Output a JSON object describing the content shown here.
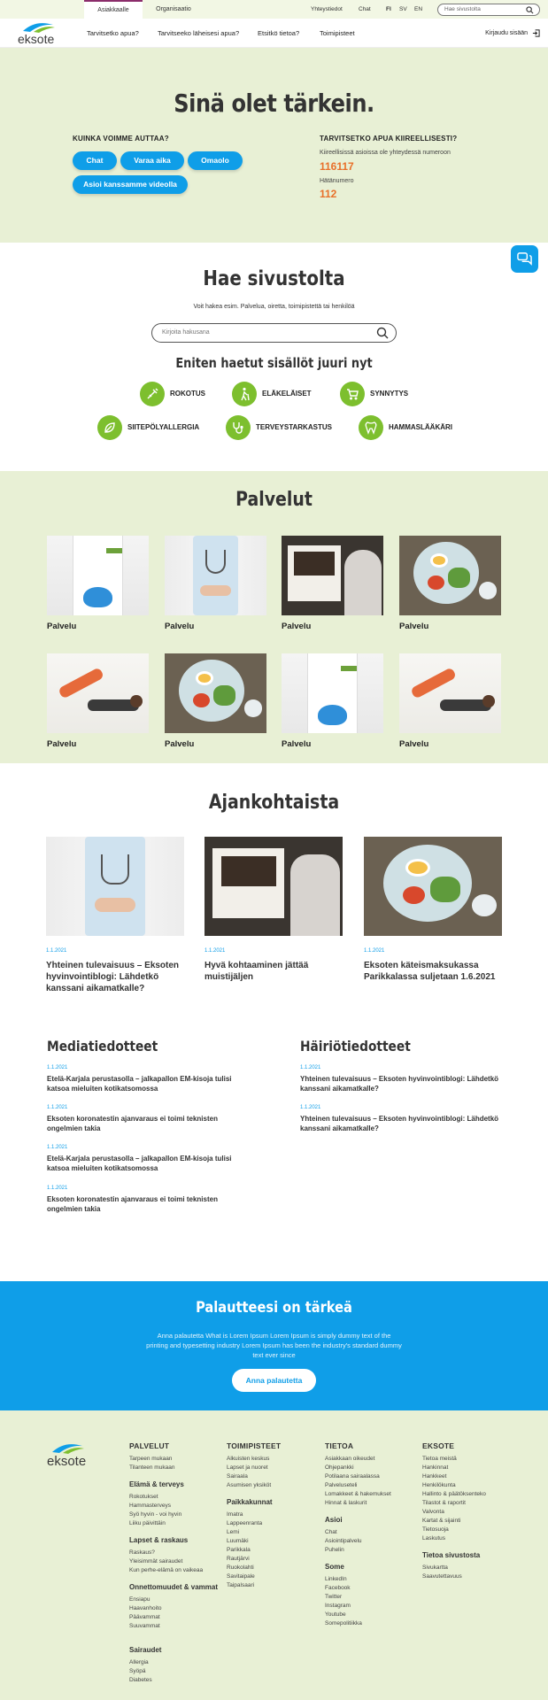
{
  "topbar": {
    "tabs": [
      "Asiakkaalle",
      "Organisaatio"
    ],
    "utils": [
      "Yhteystiedot",
      "Chat"
    ],
    "langs": [
      "FI",
      "SV",
      "EN"
    ],
    "search_placeholder": "Hae sivustolta"
  },
  "header": {
    "logo_text": "eksote",
    "nav": [
      "Tarvitsetko apua?",
      "Tarvitseeko läheisesi apua?",
      "Etsitkö tietoa?",
      "Toimipisteet"
    ],
    "login": "Kirjaudu sisään"
  },
  "hero": {
    "title": "Sinä olet tärkein.",
    "help_label": "KUINKA VOIMME AUTTAA?",
    "buttons": [
      "Chat",
      "Varaa aika",
      "Omaolo",
      "Asioi kanssamme videolla"
    ],
    "urgent_label": "TARVITSETKO APUA KIIREELLISESTI?",
    "urgent_text": "Kiireellisissä asioissa ole yhteydessä numeroon",
    "urgent_number": "116117",
    "emergency_text": "Hätänumero",
    "emergency_number": "112"
  },
  "search": {
    "title": "Hae sivustolta",
    "subtitle": "Voit hakea esim. Palvelua, oiretta, toimipistettä tai henkilöä",
    "placeholder": "Kirjoita hakusana",
    "popular_title": "Eniten haetut sisällöt juuri nyt",
    "popular": [
      "ROKOTUS",
      "ELÄKELÄISET",
      "SYNNYTYS",
      "SIITEPÖLYALLERGIA",
      "TERVEYSTARKASTUS",
      "HAMMASLÄÄKÄRI"
    ]
  },
  "services": {
    "title": "Palvelut",
    "cards": [
      "Palvelu",
      "Palvelu",
      "Palvelu",
      "Palvelu",
      "Palvelu",
      "Palvelu",
      "Palvelu",
      "Palvelu"
    ]
  },
  "news": {
    "title": "Ajankohtaista",
    "items": [
      {
        "date": "1.1.2021",
        "title": "Yhteinen tulevaisuus – Eksoten hyvinvointiblogi: Lähdetkö kanssani aikamatkalle?"
      },
      {
        "date": "1.1.2021",
        "title": "Hyvä kohtaaminen jättää muistijäljen"
      },
      {
        "date": "1.1.2021",
        "title": "Eksoten käteismaksukassa Parikkalassa suljetaan 1.6.2021"
      }
    ]
  },
  "media": {
    "title": "Mediatiedotteet",
    "items": [
      {
        "date": "1.1.2021",
        "title": "Etelä-Karjala perustasolla – jalkapallon EM-kisoja tulisi katsoa mieluiten kotikatsomossa"
      },
      {
        "date": "1.1.2021",
        "title": "Eksoten koronatestin ajanvaraus ei toimi teknisten ongelmien takia"
      },
      {
        "date": "1.1.2021",
        "title": "Etelä-Karjala perustasolla – jalkapallon EM-kisoja tulisi katsoa mieluiten kotikatsomossa"
      },
      {
        "date": "1.1.2021",
        "title": "Eksoten koronatestin ajanvaraus ei toimi teknisten ongelmien takia"
      }
    ]
  },
  "disruptions": {
    "title": "Häiriötiedotteet",
    "items": [
      {
        "date": "1.1.2021",
        "title": "Yhteinen tulevaisuus – Eksoten hyvinvointiblogi: Lähdetkö kanssani aikamatkalle?"
      },
      {
        "date": "1.1.2021",
        "title": "Yhteinen tulevaisuus – Eksoten hyvinvointiblogi: Lähdetkö kanssani aikamatkalle?"
      }
    ]
  },
  "feedback": {
    "title": "Palautteesi on tärkeä",
    "text": "Anna palautetta What is Lorem Ipsum Lorem Ipsum is simply dummy text of the printing and typesetting industry Lorem Ipsum has been the industry's standard dummy text ever since",
    "button": "Anna palautetta"
  },
  "footer": {
    "logo_text": "eksote",
    "palvelut": {
      "title": "PALVELUT",
      "links": [
        "Tarpeen mukaan",
        "Tilanteen mukaan"
      ],
      "groups": [
        {
          "title": "Elämä & terveys",
          "links": [
            "Rokotukset",
            "Hammasterveys",
            "Syö hyvin - voi hyvin",
            "Liiku päivittäin"
          ]
        },
        {
          "title": "Lapset & raskaus",
          "links": [
            "Raskaus?",
            "Yleisimmät sairaudet",
            "Kun perhe-elämä on vaikeaa"
          ]
        },
        {
          "title": "Onnettomuudet & vammat",
          "links": [
            "Ensiapu",
            "Haavanhoito",
            "Päävammat",
            "Suuvammat"
          ]
        },
        {
          "title": "Sairaudet",
          "links": [
            "Allergia",
            "Syöpä",
            "Diabetes"
          ]
        }
      ]
    },
    "toimipisteet": {
      "title": "TOIMIPISTEET",
      "links": [
        "Alkuisten keskus",
        "Lapset ja nuoret",
        "Sairaala",
        "Asumisen yksiköt"
      ],
      "group_title": "Paikkakunnat",
      "group_links": [
        "Imatra",
        "Lappeenranta",
        "Lemi",
        "Luumäki",
        "Parikkala",
        "Rautjärvi",
        "Ruokolahti",
        "Savitaipale",
        "Taipalsaari"
      ]
    },
    "tietoa": {
      "title": "TIETOA",
      "links": [
        "Asiakkaan oikeudet",
        "Ohjepankki",
        "Potilaana sairaalassa",
        "Palveluseteli",
        "Lomakkeet & hakemukset",
        "Hinnat & laskurit"
      ],
      "groups": [
        {
          "title": "Asioi",
          "links": [
            "Chat",
            "Asiointipalvelu",
            "Puhelin"
          ]
        },
        {
          "title": "Some",
          "links": [
            "LinkedIn",
            "Facebook",
            "Twitter",
            "Instagram",
            "Youtube",
            "Somepolitiikka"
          ]
        }
      ]
    },
    "eksote": {
      "title": "EKSOTE",
      "links": [
        "Tietoa meistä",
        "Hankinnat",
        "Hankkeet",
        "Henkilökunta",
        "Hallinto & päätöksenteko",
        "Tilastot & raportit",
        "Valvonta",
        "Kartat & sijainti",
        "Tietosuoja",
        "Laskutus"
      ],
      "group_title": "Tietoa sivustosta",
      "group_links": [
        "Sivukartta",
        "Saavutettavuus"
      ]
    }
  },
  "colors": {
    "accent_blue": "#0f9ee8",
    "accent_green": "#7dbf2e",
    "light_green_bg": "#e8f0d5",
    "urgent_orange": "#e8702a",
    "active_tab_purple": "#8b2d6b"
  }
}
